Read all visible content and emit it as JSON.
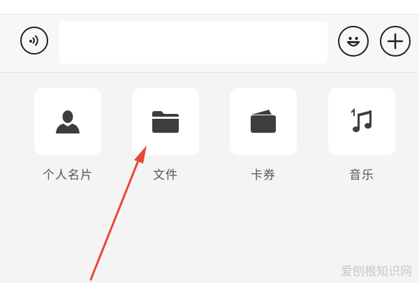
{
  "input_bar": {
    "voice_icon": "voice-icon",
    "emoji_icon": "smiley-icon",
    "plus_icon": "plus-icon",
    "text_value": ""
  },
  "tray": {
    "items": [
      {
        "label": "个人名片",
        "icon": "person-icon"
      },
      {
        "label": "文件",
        "icon": "folder-icon"
      },
      {
        "label": "卡券",
        "icon": "wallet-icon"
      },
      {
        "label": "音乐",
        "icon": "music-note-icon"
      }
    ]
  },
  "overlay": {
    "arrow_color": "#e8473a",
    "watermark": "爱刨根知识网"
  },
  "colors": {
    "icon": "#3d3d3d",
    "tile_bg": "#ffffff",
    "tray_bg": "#f4f4f4"
  }
}
